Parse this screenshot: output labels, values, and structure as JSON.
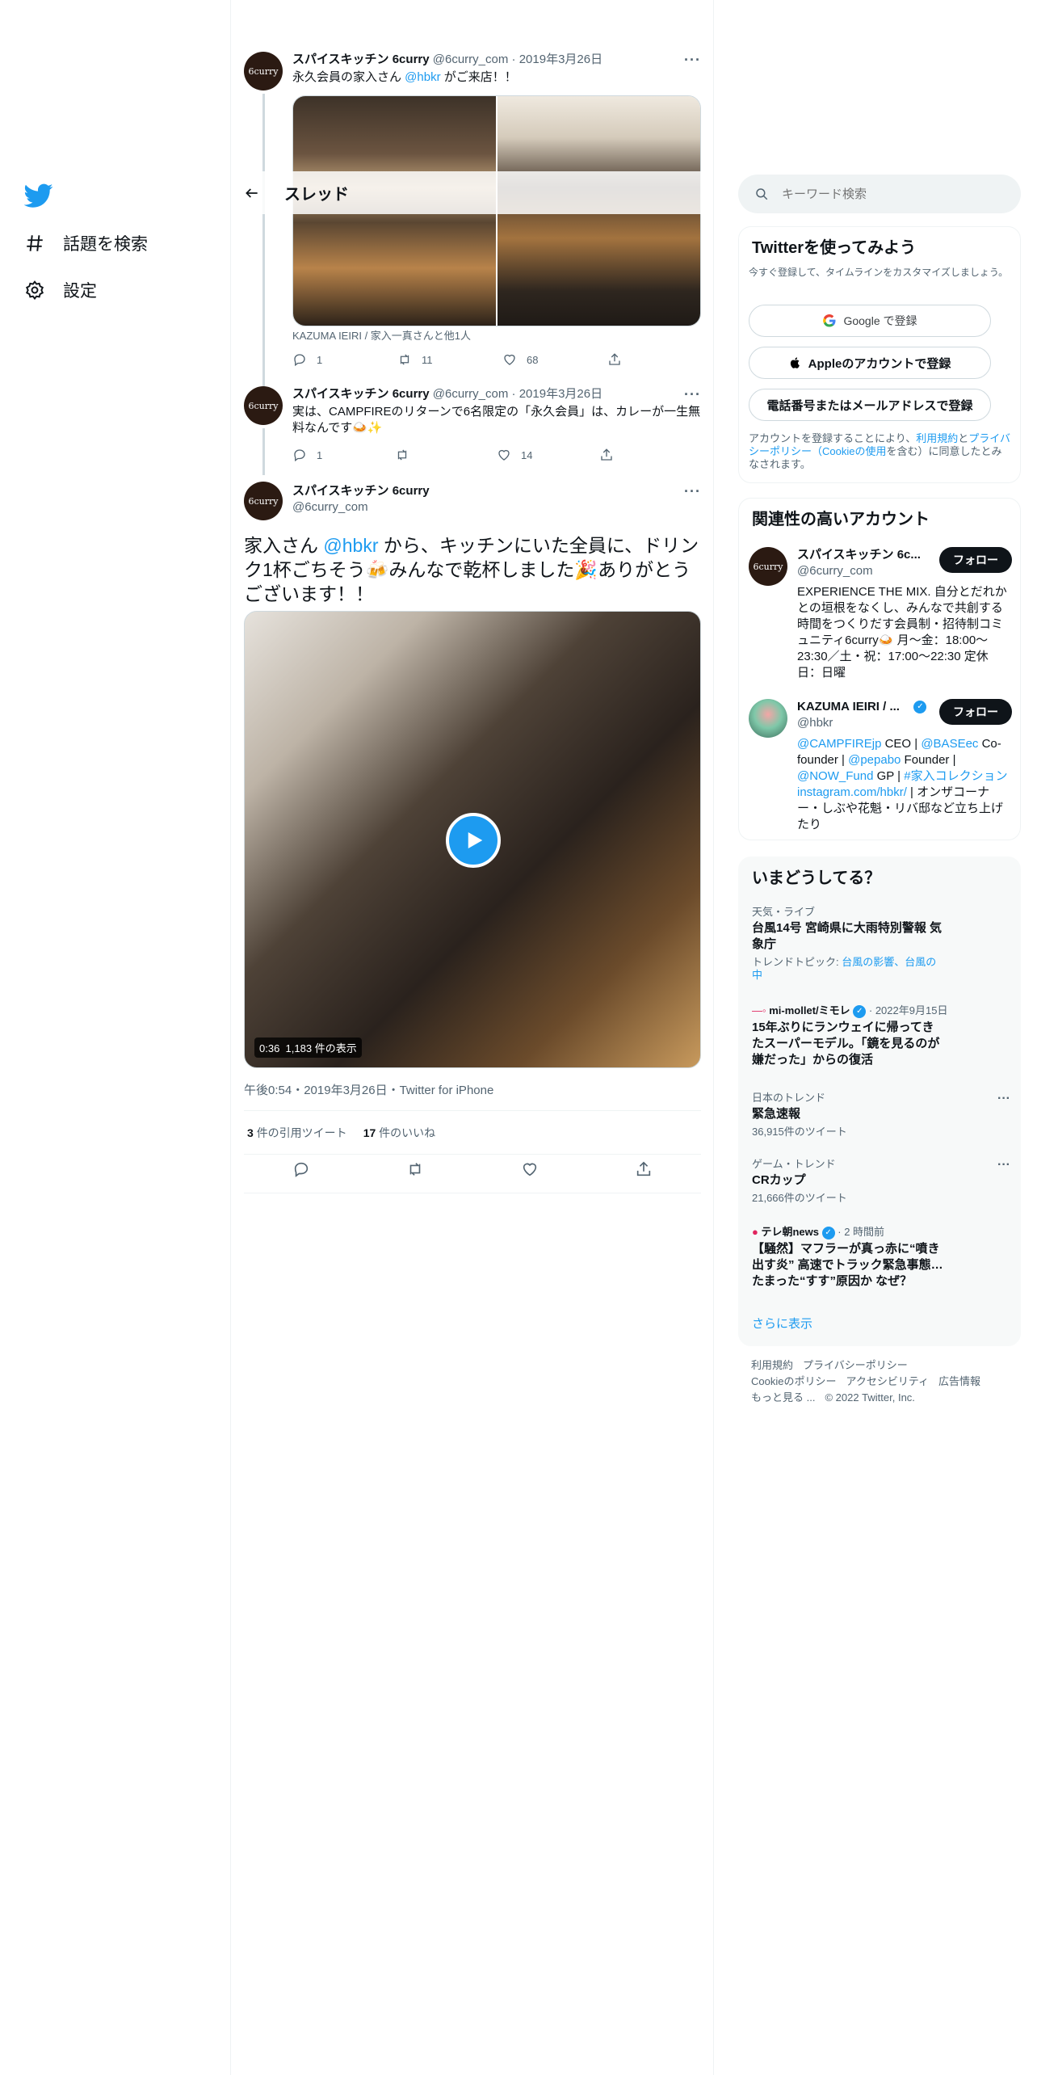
{
  "nav": {
    "explore_label": "話題を検索",
    "settings_label": "設定"
  },
  "thread": {
    "header_title": "スレッド",
    "tweet1": {
      "avatar_text": "6curry",
      "name": "スパイスキッチン 6curry",
      "handle": "@6curry_com",
      "date": "2019年3月26日",
      "text_prefix": "永久会員の家入さん ",
      "mention": "@hbkr",
      "text_suffix": " がご来店！！",
      "tag_line": "KAZUMA IEIRI / 家入一真さんと他1人",
      "replies": "1",
      "retweets": "11",
      "likes": "68"
    },
    "tweet2": {
      "avatar_text": "6curry",
      "name": "スパイスキッチン 6curry",
      "handle": "@6curry_com",
      "date": "2019年3月26日",
      "text": "実は、CAMPFIREのリターンで6名限定の「永久会員」は、カレーが一生無料なんです🍛✨",
      "replies": "1",
      "retweets": "",
      "likes": "14"
    },
    "focus": {
      "avatar_text": "6curry",
      "name": "スパイスキッチン 6curry",
      "handle": "@6curry_com",
      "text_prefix": "家入さん ",
      "mention": "@hbkr",
      "text_suffix": " から、キッチンにいた全員に、ドリンク1杯ごちそう🍻みんなで乾杯しました🎉ありがとうございます！！",
      "video_duration": "0:36",
      "video_views": "1,183 件の表示",
      "timestamp": "午後0:54・2019年3月26日・Twitter for iPhone",
      "quote_count": "3",
      "quote_label": "件の引用ツイート",
      "like_count": "17",
      "like_label": "件のいいね"
    }
  },
  "search": {
    "placeholder": "キーワード検索"
  },
  "signup": {
    "title": "Twitterを使ってみよう",
    "subtitle": "今すぐ登録して、タイムラインをカスタマイズしましょう。",
    "google": "Google で登録",
    "apple": "Appleのアカウントで登録",
    "phone": "電話番号またはメールアドレスで登録",
    "legal_prefix": "アカウントを登録することにより、",
    "legal_terms": "利用規約",
    "legal_and": "と",
    "legal_privacy": "プライバシーポリシー（Cookieの使用",
    "legal_suffix": "を含む）に同意したとみなされます。"
  },
  "related": {
    "title": "関連性の高いアカウント",
    "accounts": [
      {
        "avatar_text": "6curry",
        "name": "スパイスキッチン 6c...",
        "handle": "@6curry_com",
        "follow": "フォロー",
        "bio": "EXPERIENCE THE MIX. 自分とだれかとの垣根をなくし、みんなで共創する時間をつくりだす会員制・招待制コミュニティ6curry🍛 月〜金：18:00〜23:30／土・祝：17:00〜22:30 定休日：日曜"
      },
      {
        "name": "KAZUMA IEIRI / ...",
        "handle": "@hbkr",
        "follow": "フォロー",
        "bio_parts": [
          "@CAMPFIREjp",
          " CEO | ",
          "@BASEec",
          " Co-founder | ",
          "@pepabo",
          " Founder | ",
          "@NOW_Fund",
          " GP | ",
          "#家入コレクション",
          " ",
          "instagram.com/hbkr/",
          " | オンザコーナー・しぶや花魁・リバ邸など立ち上げたり"
        ]
      }
    ]
  },
  "trends": {
    "title": "いまどうしてる？",
    "items": [
      {
        "category": "天気・ライブ",
        "title": "台風14号 宮崎県に大雨特別警報 気象庁",
        "sub_prefix": "トレンドトピック: ",
        "sub_links": "台風の影響、台風の中"
      },
      {
        "source": "mi-mollet/ミモレ",
        "date": "2022年9月15日",
        "title": "15年ぶりにランウェイに帰ってきたスーパーモデル。「鏡を見るのが嫌だった」からの復活"
      },
      {
        "category": "日本のトレンド",
        "title": "緊急速報",
        "sub": "36,915件のツイート"
      },
      {
        "category": "ゲーム・トレンド",
        "title": "CRカップ",
        "sub": "21,666件のツイート"
      },
      {
        "source": "テレ朝news",
        "date": "2 時間前",
        "title": "【騒然】マフラーが真っ赤に“噴き出す炎” 高速でトラック緊急事態…たまった“すす”原因か なぜ？"
      }
    ],
    "show_more": "さらに表示"
  },
  "footer": {
    "links": [
      "利用規約",
      "プライバシーポリシー",
      "Cookieのポリシー",
      "アクセシビリティ",
      "広告情報",
      "もっと見る ..."
    ],
    "copyright": "© 2022 Twitter, Inc."
  }
}
